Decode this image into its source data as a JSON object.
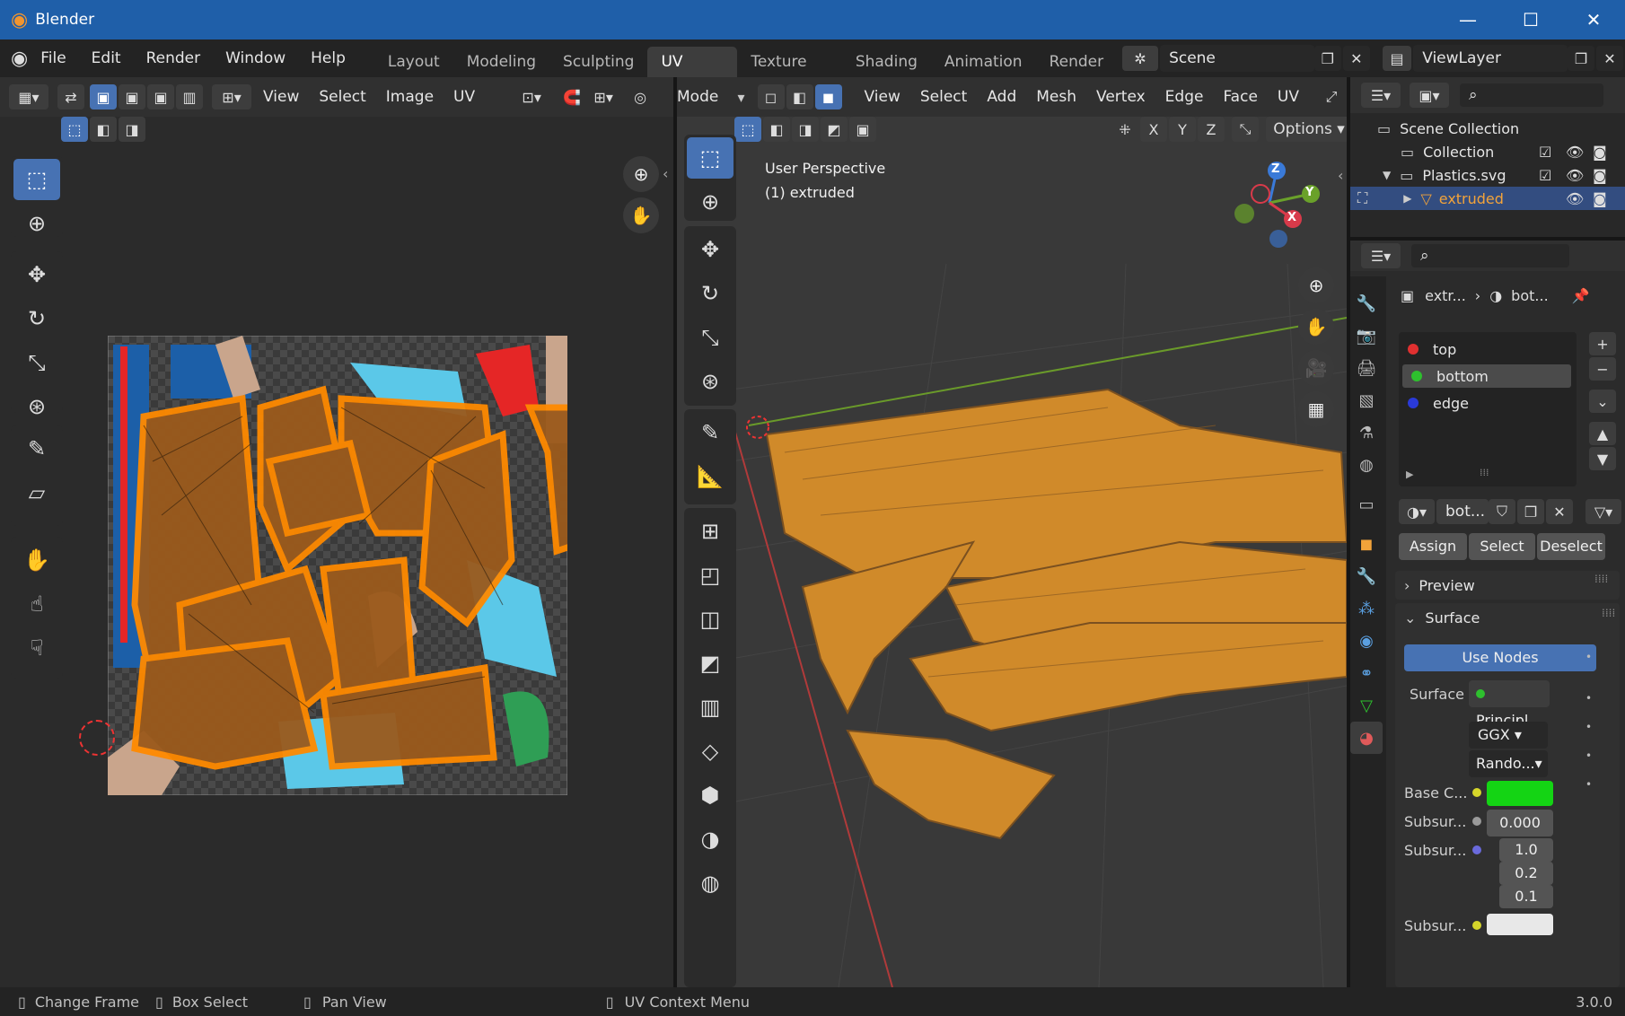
{
  "title_bar": {
    "app_title": "Blender",
    "minimize": "—",
    "maximize": "☐",
    "close": "✕"
  },
  "top_menu": [
    "File",
    "Edit",
    "Render",
    "Window",
    "Help"
  ],
  "workspaces": [
    "Layout",
    "Modeling",
    "Sculpting",
    "UV Editing",
    "Texture Paint",
    "Shading",
    "Animation",
    "Render"
  ],
  "active_workspace": "UV Editing",
  "scene_name": "Scene",
  "view_layer": "ViewLayer",
  "uv_editor": {
    "menus": [
      "View",
      "Select",
      "Image",
      "UV"
    ]
  },
  "viewport": {
    "mode": "Mode",
    "menus": [
      "View",
      "Select",
      "Add",
      "Mesh",
      "Vertex",
      "Edge",
      "Face",
      "UV"
    ],
    "axis_buttons": [
      "X",
      "Y",
      "Z"
    ],
    "options_label": "Options",
    "overlay_line1": "User Perspective",
    "overlay_line2": "(1) extruded",
    "gizmo": {
      "x": "X",
      "y": "Y",
      "z": "Z"
    }
  },
  "outliner": {
    "scene_collection": "Scene Collection",
    "items": [
      {
        "label": "Collection"
      },
      {
        "label": "Plastics.svg"
      },
      {
        "label": "extruded"
      }
    ]
  },
  "properties": {
    "breadcrumb_object": "extr...",
    "breadcrumb_material": "bot...",
    "material_slots": [
      {
        "label": "top",
        "color": "#e03030"
      },
      {
        "label": "bottom",
        "color": "#2ec02e"
      },
      {
        "label": "edge",
        "color": "#2a3ad8"
      }
    ],
    "material_name": "bot...",
    "assign": "Assign",
    "select": "Select",
    "deselect": "Deselect",
    "preview_panel": "Preview",
    "surface_panel": "Surface",
    "use_nodes": "Use Nodes",
    "surface_label": "Surface",
    "surface_value": "Principl...",
    "distribution": "GGX",
    "subsurface_method": "Rando...",
    "base_color_label": "Base C...",
    "base_color": "#14d414",
    "subsurface_label": "Subsur...",
    "subsurface_value": "0.000",
    "subsurface_radius_label": "Subsur...",
    "subsurface_radius": [
      "1.0",
      "0.2",
      "0.1"
    ],
    "subsurface_color_label": "Subsur..."
  },
  "status_bar": {
    "items": [
      "Change Frame",
      "Box Select",
      "Pan View",
      "UV Context Menu"
    ],
    "version": "3.0.0"
  },
  "colors": {
    "accent": "#4772b3",
    "title_bar": "#1f5fa9",
    "selected_uv": "#ff8a00",
    "object_orange": "#f2a33a"
  }
}
